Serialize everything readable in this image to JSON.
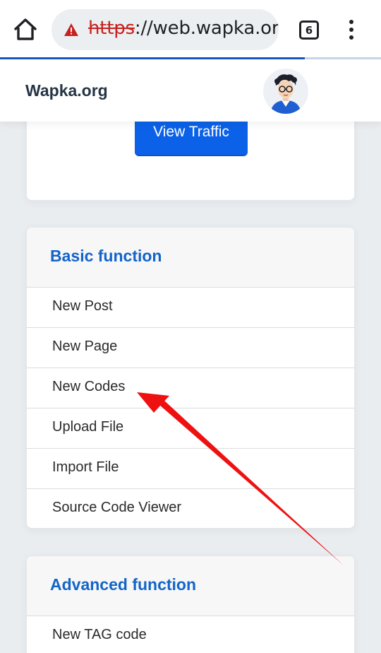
{
  "browser": {
    "url_scheme": "https",
    "url_rest": "://web.wapka.org/p",
    "tab_count": "6",
    "progress_fraction": 0.8
  },
  "site": {
    "title": "Wapka.org"
  },
  "top_card": {
    "button_label": "View Traffic"
  },
  "basic_function": {
    "title": "Basic function",
    "items": [
      "New Post",
      "New Page",
      "New Codes",
      "Upload File",
      "Import File",
      "Source Code Viewer"
    ]
  },
  "advanced_function": {
    "title": "Advanced function",
    "items": [
      "New TAG code"
    ]
  },
  "annotation": {
    "arrow_color": "#ee1111",
    "points_to": "New Codes"
  },
  "colors": {
    "accent": "#1364c8",
    "button": "#0b62e8",
    "warning": "#c5221f"
  }
}
